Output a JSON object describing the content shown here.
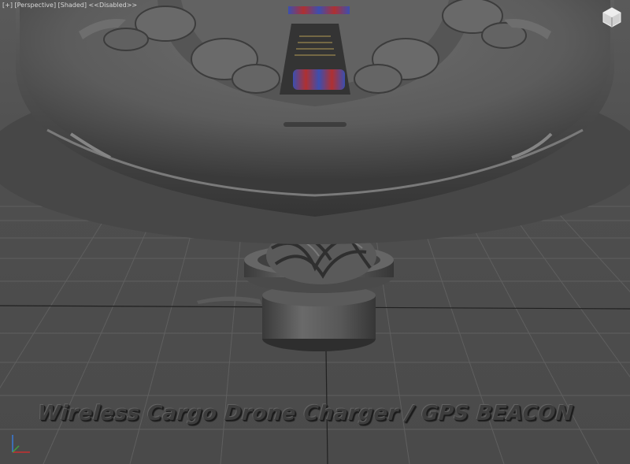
{
  "viewport": {
    "labels": [
      "[+]",
      "[Perspective]",
      "[Shaded]",
      "<<Disabled>>"
    ],
    "caption": "Wireless Cargo Drone Charger / GPS BEACON"
  },
  "icons": {
    "viewcube": "viewcube-home-icon",
    "axis": "axis-tripod-icon"
  },
  "colors": {
    "background": "#4d4d4d",
    "grid": "#5e5e5e",
    "grid_axis": "#1e1e1e",
    "model": "#5d5d5d",
    "stripe_blue": "#3b4fb0",
    "stripe_red": "#b03030"
  }
}
